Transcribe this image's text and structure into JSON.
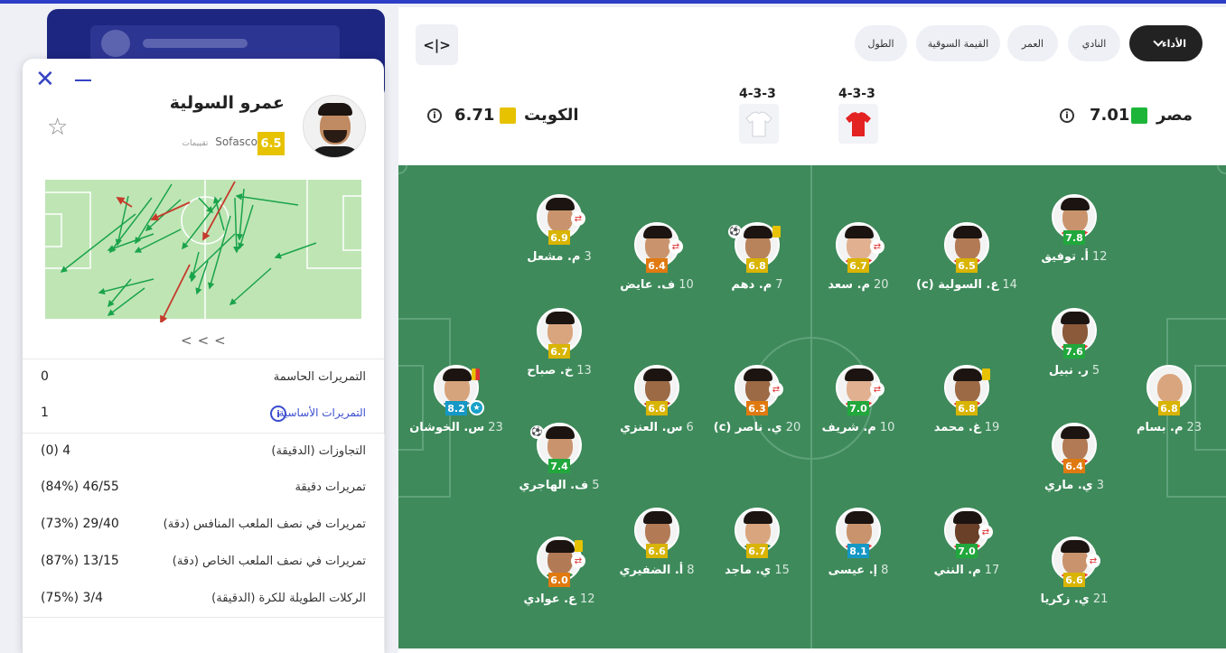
{
  "filters": {
    "active": "الأداء",
    "chips": [
      "النادي",
      "العمر",
      "القيمة السوقية",
      "الطول"
    ],
    "code_button": "<|>"
  },
  "home": {
    "name": "مصر",
    "rating": "7.01",
    "formation": "4-3-3",
    "rating_color": "#1db539",
    "kit_color": "#e32222"
  },
  "away": {
    "name": "الكويت",
    "rating": "6.71",
    "formation": "4-3-3",
    "rating_color": "#e6c200",
    "kit_color": "#ffffff"
  },
  "players": [
    {
      "name": "أ. توفيق",
      "number": "12",
      "rating": "7.8",
      "color": "#21a83c",
      "side": "home"
    },
    {
      "name": "ع. السولية (c)",
      "number": "14",
      "rating": "6.5",
      "color": "#d9b400",
      "side": "home"
    },
    {
      "name": "م. سعد",
      "number": "20",
      "rating": "6.7",
      "color": "#d9b400",
      "side": "home"
    },
    {
      "name": "م. دهم",
      "number": "7",
      "rating": "6.8",
      "color": "#d9b400",
      "side": "away"
    },
    {
      "name": "ف. عايض",
      "number": "10",
      "rating": "6.4",
      "color": "#e07a10",
      "side": "away"
    },
    {
      "name": "م. مشعل",
      "number": "3",
      "rating": "6.9",
      "color": "#d9b400",
      "side": "away"
    },
    {
      "name": "ر. نبيل",
      "number": "5",
      "rating": "7.6",
      "color": "#21a83c",
      "side": "home"
    },
    {
      "name": "خ. صباح",
      "number": "13",
      "rating": "6.7",
      "color": "#d9b400",
      "side": "away"
    },
    {
      "name": "م. بسام",
      "number": "23",
      "rating": "6.8",
      "color": "#d9b400",
      "side": "home"
    },
    {
      "name": "غ. محمد",
      "number": "19",
      "rating": "6.8",
      "color": "#d9b400",
      "side": "home"
    },
    {
      "name": "م. شريف",
      "number": "10",
      "rating": "7.0",
      "color": "#21a83c",
      "side": "home"
    },
    {
      "name": "ي. ناصر (c)",
      "number": "20",
      "rating": "6.3",
      "color": "#e07a10",
      "side": "away"
    },
    {
      "name": "س. العنزي",
      "number": "6",
      "rating": "6.6",
      "color": "#d9b400",
      "side": "away"
    },
    {
      "name": "س. الخوشان",
      "number": "23",
      "rating": "8.2",
      "color": "#1598c6",
      "side": "away"
    },
    {
      "name": "ي. ماري",
      "number": "3",
      "rating": "6.4",
      "color": "#e07a10",
      "side": "home"
    },
    {
      "name": "ف. الهاجري",
      "number": "5",
      "rating": "7.4",
      "color": "#21a83c",
      "side": "away"
    },
    {
      "name": "ي. زكريا",
      "number": "21",
      "rating": "6.6",
      "color": "#d9b400",
      "side": "home"
    },
    {
      "name": "م. النني",
      "number": "17",
      "rating": "7.0",
      "color": "#21a83c",
      "side": "home"
    },
    {
      "name": "إ. عيسى",
      "number": "8",
      "rating": "8.1",
      "color": "#1598c6",
      "side": "home"
    },
    {
      "name": "ي. ماجد",
      "number": "15",
      "rating": "6.7",
      "color": "#d9b400",
      "side": "away"
    },
    {
      "name": "أ. الضفيري",
      "number": "8",
      "rating": "6.6",
      "color": "#d9b400",
      "side": "away"
    },
    {
      "name": "ع. عوادي",
      "number": "12",
      "rating": "6.0",
      "color": "#e07a10",
      "side": "away"
    }
  ],
  "panel": {
    "player_name": "عمرو السولية",
    "provider": "Sofascore",
    "ratings_label": "تقييمات",
    "rating": "6.5",
    "rating_color": "#e6c200",
    "carousel": "<<<",
    "stats": [
      {
        "label": "التمريرات الحاسمة",
        "value": "0"
      },
      {
        "label": "التمريرات الأساسية",
        "value": "1",
        "link": true
      },
      {
        "label": "التجاوزات (الدقيقة)",
        "value": "(0) 4"
      },
      {
        "label": "تمريرات دقيقة",
        "value": "(84%) 46/55"
      },
      {
        "label": "تمريرات في نصف الملعب المنافس (دقة)",
        "value": "(73%) 29/40"
      },
      {
        "label": "تمريرات في نصف الملعب الخاص (دقة)",
        "value": "(87%) 13/15"
      },
      {
        "label": "الركلات الطويلة للكرة (الدقيقة)",
        "value": "(75%) 3/4"
      }
    ]
  }
}
